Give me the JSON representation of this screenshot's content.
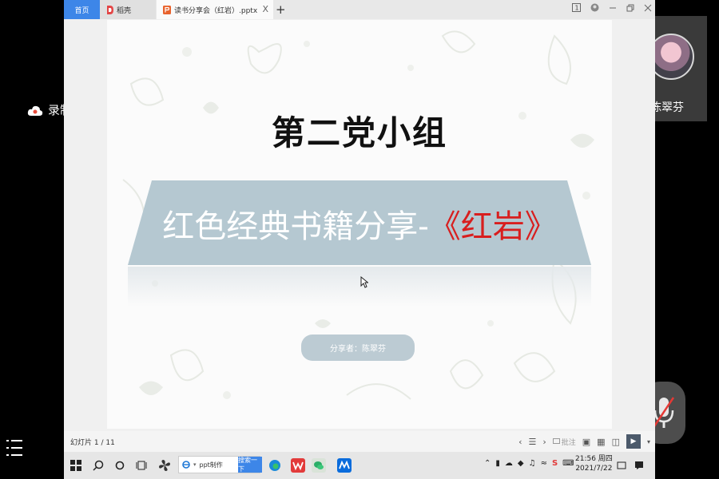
{
  "overlay": {
    "recording_label": "录制中",
    "participant_name": "陈翠芬"
  },
  "tabs": {
    "home": "首页",
    "docer": "稻壳",
    "file": "读书分享会（红岩）.pptx",
    "close": "X",
    "add": "+"
  },
  "slide": {
    "title": "第二党小组",
    "banner_text": "红色经典书籍分享-",
    "banner_highlight": "《红岩》",
    "presenter": "分享者：陈翠芬"
  },
  "statusbar": {
    "slide_counter": "幻灯片 1 / 11",
    "notes_label": "批注"
  },
  "taskbar": {
    "search_text": "ppt制作",
    "search_button": "搜索一下",
    "time": "21:56 周四",
    "date": "2021/7/22"
  },
  "colors": {
    "banner": "#b5c8d1",
    "accent_red": "#d81e1e",
    "tab_active": "#3d86e8"
  }
}
